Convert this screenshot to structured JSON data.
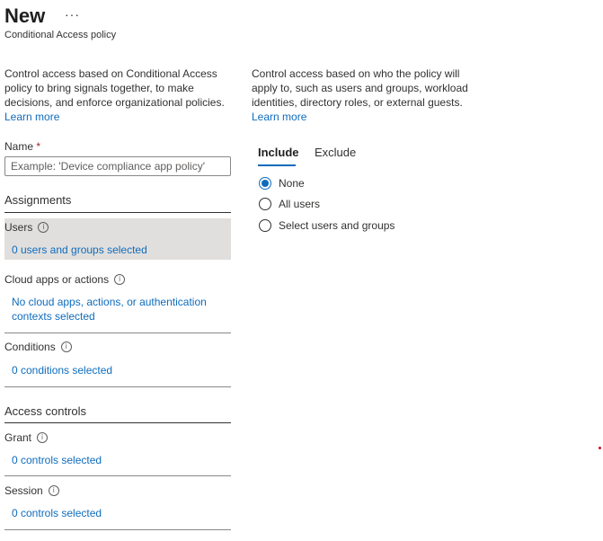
{
  "header": {
    "title": "New",
    "more": "···",
    "subtitle": "Conditional Access policy"
  },
  "left_intro": {
    "text": "Control access based on Conditional Access policy to bring signals together, to make decisions, and enforce organizational policies.",
    "link": "Learn more"
  },
  "right_intro": {
    "text": "Control access based on who the policy will apply to, such as users and groups, workload identities, directory roles, or external guests.",
    "link": "Learn more"
  },
  "name_field": {
    "label": "Name",
    "required": "*",
    "placeholder": "Example: 'Device compliance app policy'"
  },
  "assignments": {
    "heading": "Assignments",
    "users": {
      "label": "Users",
      "value": "0 users and groups selected"
    },
    "cloud_apps": {
      "label": "Cloud apps or actions",
      "value": "No cloud apps, actions, or authentication contexts selected"
    },
    "conditions": {
      "label": "Conditions",
      "value": "0 conditions selected"
    }
  },
  "access_controls": {
    "heading": "Access controls",
    "grant": {
      "label": "Grant",
      "value": "0 controls selected"
    },
    "session": {
      "label": "Session",
      "value": "0 controls selected"
    }
  },
  "tabs": [
    {
      "label": "Include",
      "active": true
    },
    {
      "label": "Exclude",
      "active": false
    }
  ],
  "radio_options": [
    {
      "label": "None",
      "checked": true
    },
    {
      "label": "All users",
      "checked": false
    },
    {
      "label": "Select users and groups",
      "checked": false
    }
  ],
  "colors": {
    "accent": "#0f6cbd",
    "selected_bg": "#e1dfdd",
    "required": "#a4262c"
  },
  "icons": {
    "info": "info-icon",
    "radio": "radio-icon"
  }
}
